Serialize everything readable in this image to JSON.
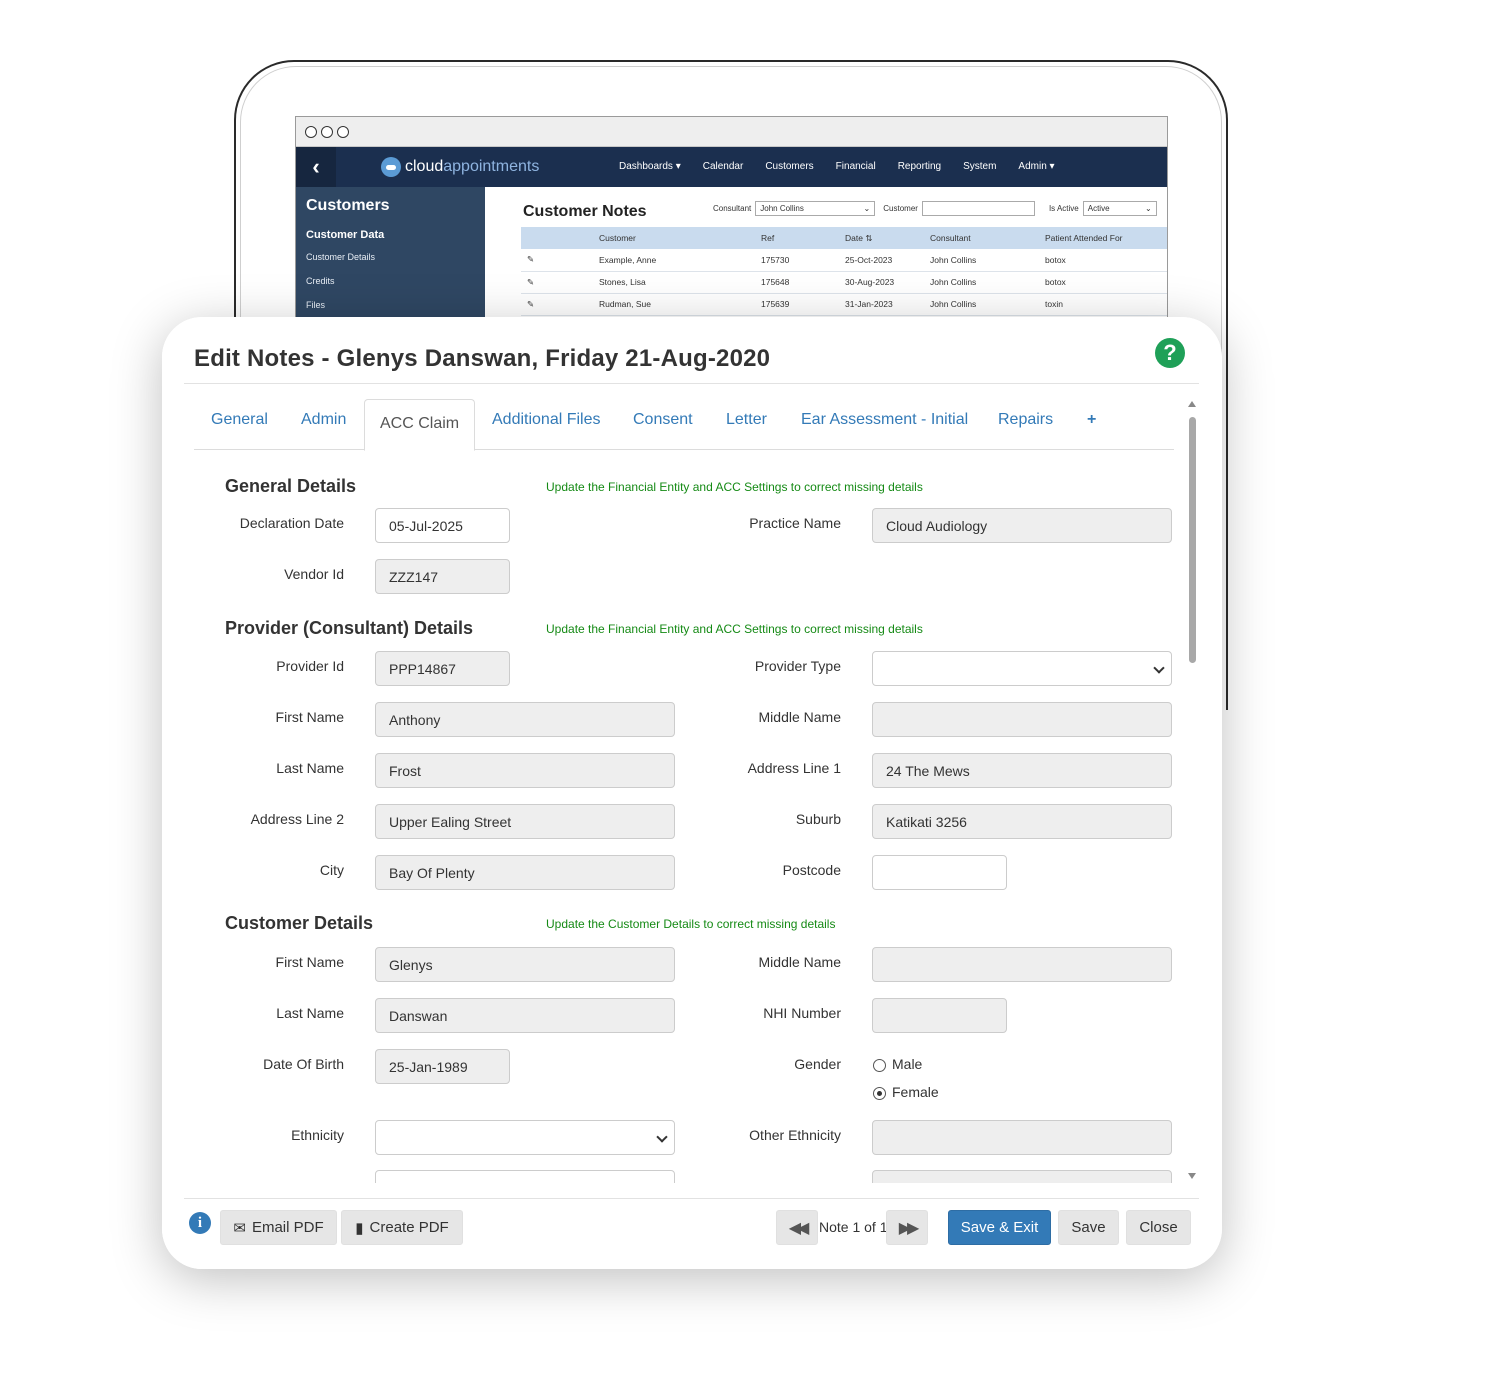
{
  "background_app": {
    "brand": {
      "part1": "cloud",
      "part2": "appointments"
    },
    "nav": [
      "Dashboards ▾",
      "Calendar",
      "Customers",
      "Financial",
      "Reporting",
      "System",
      "Admin ▾"
    ],
    "sidebar": {
      "title": "Customers",
      "section": "Customer Data",
      "items": [
        "Customer Details",
        "Credits",
        "Files"
      ]
    },
    "notes_title": "Customer Notes",
    "filters": {
      "consultant_label": "Consultant",
      "consultant_value": "John Collins",
      "customer_label": "Customer",
      "customer_value": "",
      "active_label": "Is Active",
      "active_value": "Active"
    },
    "table": {
      "headers": [
        "",
        "Customer",
        "Ref",
        "Date ⇅",
        "Consultant",
        "Patient Attended For"
      ],
      "rows": [
        [
          "✎",
          "Example, Anne",
          "175730",
          "25-Oct-2023",
          "John Collins",
          "botox"
        ],
        [
          "✎",
          "Stones, Lisa",
          "175648",
          "30-Aug-2023",
          "John Collins",
          "botox"
        ],
        [
          "✎",
          "Rudman, Sue",
          "175639",
          "31-Jan-2023",
          "John Collins",
          "toxin"
        ]
      ]
    }
  },
  "modal": {
    "title": "Edit Notes - Glenys Danswan, Friday 21-Aug-2020",
    "tabs": [
      "General",
      "Admin",
      "ACC Claim",
      "Additional Files",
      "Consent",
      "Letter",
      "Ear Assessment - Initial",
      "Repairs",
      "+"
    ],
    "active_tab": "ACC Claim",
    "general": {
      "title": "General Details",
      "note": "Update the Financial Entity and ACC Settings to correct missing details",
      "declaration_date_label": "Declaration Date",
      "declaration_date": "05-Jul-2025",
      "practice_name_label": "Practice Name",
      "practice_name": "Cloud Audiology",
      "vendor_id_label": "Vendor Id",
      "vendor_id": "ZZZ147"
    },
    "provider": {
      "title": "Provider (Consultant) Details",
      "note": "Update the Financial Entity and ACC Settings to correct missing details",
      "provider_id_label": "Provider Id",
      "provider_id": "PPP14867",
      "provider_type_label": "Provider Type",
      "provider_type": "",
      "first_name_label": "First Name",
      "first_name": "Anthony",
      "middle_name_label": "Middle Name",
      "middle_name": "",
      "last_name_label": "Last Name",
      "last_name": "Frost",
      "address1_label": "Address Line 1",
      "address1": "24 The Mews",
      "address2_label": "Address Line 2",
      "address2": "Upper Ealing Street",
      "suburb_label": "Suburb",
      "suburb": "Katikati 3256",
      "city_label": "City",
      "city": "Bay Of Plenty",
      "postcode_label": "Postcode",
      "postcode": ""
    },
    "customer": {
      "title": "Customer Details",
      "note": "Update the Customer Details to correct missing details",
      "first_name_label": "First Name",
      "first_name": "Glenys",
      "middle_name_label": "Middle Name",
      "middle_name": "",
      "last_name_label": "Last Name",
      "last_name": "Danswan",
      "nhi_label": "NHI Number",
      "nhi": "",
      "dob_label": "Date Of Birth",
      "dob": "25-Jan-1989",
      "gender_label": "Gender",
      "gender_options": [
        "Male",
        "Female"
      ],
      "gender_selected": "Female",
      "ethnicity_label": "Ethnicity",
      "ethnicity": "",
      "other_ethnicity_label": "Other Ethnicity",
      "other_ethnicity": ""
    },
    "footer": {
      "email_pdf": "Email PDF",
      "create_pdf": "Create PDF",
      "pager": "Note 1 of 1",
      "save_exit": "Save & Exit",
      "save": "Save",
      "close": "Close"
    }
  }
}
